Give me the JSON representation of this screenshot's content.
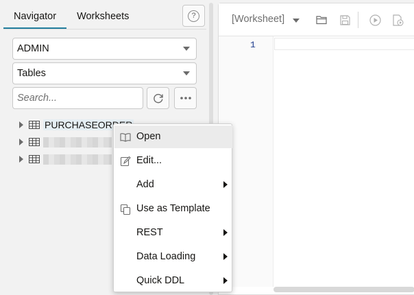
{
  "navigator": {
    "tabs": [
      {
        "label": "Navigator",
        "active": true
      },
      {
        "label": "Worksheets",
        "active": false
      }
    ],
    "help_label": "?",
    "schema_select": "ADMIN",
    "object_type_select": "Tables",
    "search_placeholder": "Search...",
    "tree_items": [
      {
        "label": "PURCHASEORDER",
        "highlighted": true
      },
      {
        "label": "",
        "redacted": true
      },
      {
        "label": "",
        "redacted": true
      }
    ]
  },
  "worksheet": {
    "title": "[Worksheet]",
    "line_numbers": [
      "1"
    ]
  },
  "context_menu": {
    "items": [
      {
        "label": "Open",
        "icon": "book-open-icon",
        "submenu": false,
        "hover": true
      },
      {
        "label": "Edit...",
        "icon": "pencil-icon",
        "submenu": false
      },
      {
        "label": "Add",
        "icon": "",
        "submenu": true
      },
      {
        "label": "Use as Template",
        "icon": "copy-icon",
        "submenu": false
      },
      {
        "label": "REST",
        "icon": "",
        "submenu": true
      },
      {
        "label": "Data Loading",
        "icon": "",
        "submenu": true
      },
      {
        "label": "Quick DDL",
        "icon": "",
        "submenu": true
      }
    ]
  },
  "colors": {
    "accent": "#227e9e",
    "line_number": "#1c3a8c",
    "menu_hover": "#ebebeb"
  }
}
